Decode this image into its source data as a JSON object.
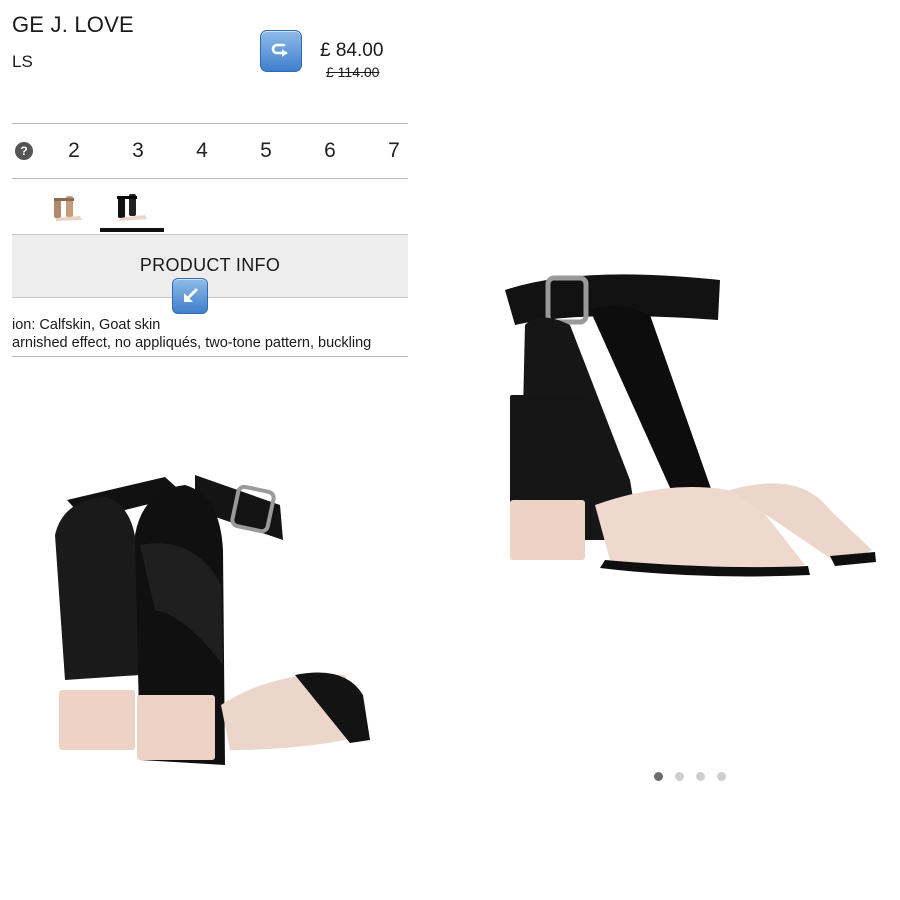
{
  "product": {
    "brand": "GE J. LOVE",
    "category": "LS",
    "price": "£ 84.00",
    "old_price": "£ 114.00"
  },
  "sizes": {
    "help_icon": "?",
    "options": [
      "2",
      "3",
      "4",
      "5",
      "6",
      "7"
    ]
  },
  "colors": {
    "swatches": [
      {
        "name": "tan-sandal-swatch",
        "selected": false
      },
      {
        "name": "black-sandal-swatch",
        "selected": true
      }
    ]
  },
  "product_info": {
    "label": "PRODUCT INFO",
    "composition": "ion: Calfskin, Goat skin",
    "details": "arnished effect, no appliqués, two-tone pattern, buckling"
  },
  "carousel": {
    "page_count": 4,
    "active_index": 0
  },
  "icons": {
    "share": "share-arrow-icon",
    "collapse": "diagonal-arrow-icon"
  },
  "theme": {
    "accent": "#3f7fcc",
    "bar_bg": "#ededed"
  }
}
